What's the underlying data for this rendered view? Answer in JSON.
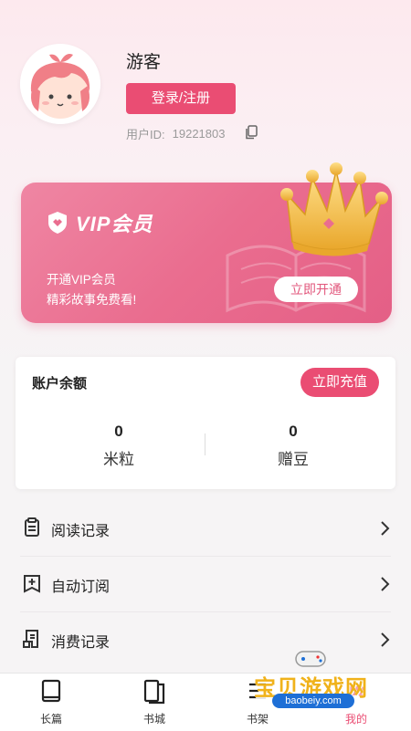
{
  "profile": {
    "username": "游客",
    "login_label": "登录/注册",
    "uid_label": "用户ID:",
    "uid_value": "19221803"
  },
  "vip": {
    "title": "VIP会员",
    "desc_line1": "开通VIP会员",
    "desc_line2": "精彩故事免费看!",
    "open_label": "立即开通"
  },
  "balance": {
    "title": "账户余额",
    "recharge_label": "立即充值",
    "items": [
      {
        "value": "0",
        "label": "米粒"
      },
      {
        "value": "0",
        "label": "赠豆"
      }
    ]
  },
  "menu": [
    {
      "label": "阅读记录",
      "icon": "document-icon"
    },
    {
      "label": "自动订阅",
      "icon": "bookmark-plus-icon"
    },
    {
      "label": "消费记录",
      "icon": "receipt-icon"
    }
  ],
  "tabbar": [
    {
      "label": "长篇",
      "icon": "book-icon"
    },
    {
      "label": "书城",
      "icon": "books-icon"
    },
    {
      "label": "书架",
      "icon": "bookshelf-icon"
    },
    {
      "label": "我的",
      "icon": "profile-icon"
    }
  ],
  "watermark": {
    "text": "宝贝游戏网",
    "url": "baobeiy.com"
  },
  "colors": {
    "accent": "#ea4d73",
    "vip_gradient_start": "#ef86a3",
    "vip_gradient_end": "#e45f86",
    "crown": "#f3c24f"
  }
}
